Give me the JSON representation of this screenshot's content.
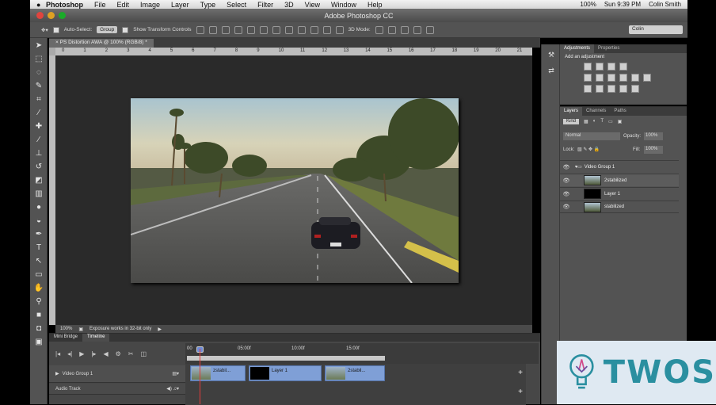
{
  "menubar": {
    "app_name": "Photoshop",
    "items": [
      "File",
      "Edit",
      "Image",
      "Layer",
      "Type",
      "Select",
      "Filter",
      "3D",
      "View",
      "Window",
      "Help"
    ],
    "status": {
      "battery": "100%",
      "time": "Sun 9:39 PM",
      "user": "Colin Smith"
    }
  },
  "window": {
    "title": "Adobe Photoshop CC"
  },
  "options_bar": {
    "auto_select_label": "Auto-Select:",
    "auto_select_value": "Group",
    "transform_label": "Show Transform Controls",
    "mode_label": "3D Mode:",
    "workspace": "Colin"
  },
  "document": {
    "tab_label": "PS Distortion AWA @ 100% (RGB/8) *",
    "ruler_ticks": [
      "0",
      "1",
      "2",
      "3",
      "4",
      "5",
      "6",
      "7",
      "8",
      "9",
      "10",
      "11",
      "12",
      "13",
      "14",
      "15",
      "16",
      "17",
      "18",
      "19",
      "20",
      "21"
    ],
    "zoom": "100%",
    "status_message": "Exposure works in 32-bit only"
  },
  "timeline": {
    "tabs": [
      "Mini Bridge",
      "Timeline"
    ],
    "ruler_labels": [
      "00",
      "05:00f",
      "10:00f",
      "15:00f"
    ],
    "tracks": [
      {
        "name": "Video Group 1"
      },
      {
        "name": "Audio Track"
      }
    ],
    "clips": [
      {
        "label": "zstabil..."
      },
      {
        "label": "Layer 1"
      },
      {
        "label": "2stabil..."
      }
    ]
  },
  "adjustments": {
    "tabs": [
      "Adjustments",
      "Properties"
    ],
    "title": "Add an adjustment"
  },
  "layers": {
    "tabs": [
      "Layers",
      "Channels",
      "Paths"
    ],
    "kind": "Kind",
    "blend_mode": "Normal",
    "opacity_label": "Opacity:",
    "opacity": "100%",
    "lock_label": "Lock:",
    "fill_label": "Fill:",
    "fill": "100%",
    "items": [
      {
        "name": "Video Group 1"
      },
      {
        "name": "2stabilized"
      },
      {
        "name": "Layer 1"
      },
      {
        "name": "stabilized"
      }
    ]
  },
  "watermark": {
    "text": "TWOS"
  },
  "colors": {
    "accent_blue": "#7f9fd6",
    "playhead": "#e23b3b",
    "panel_bg": "#535353",
    "watermark": "#2a8fa0"
  }
}
